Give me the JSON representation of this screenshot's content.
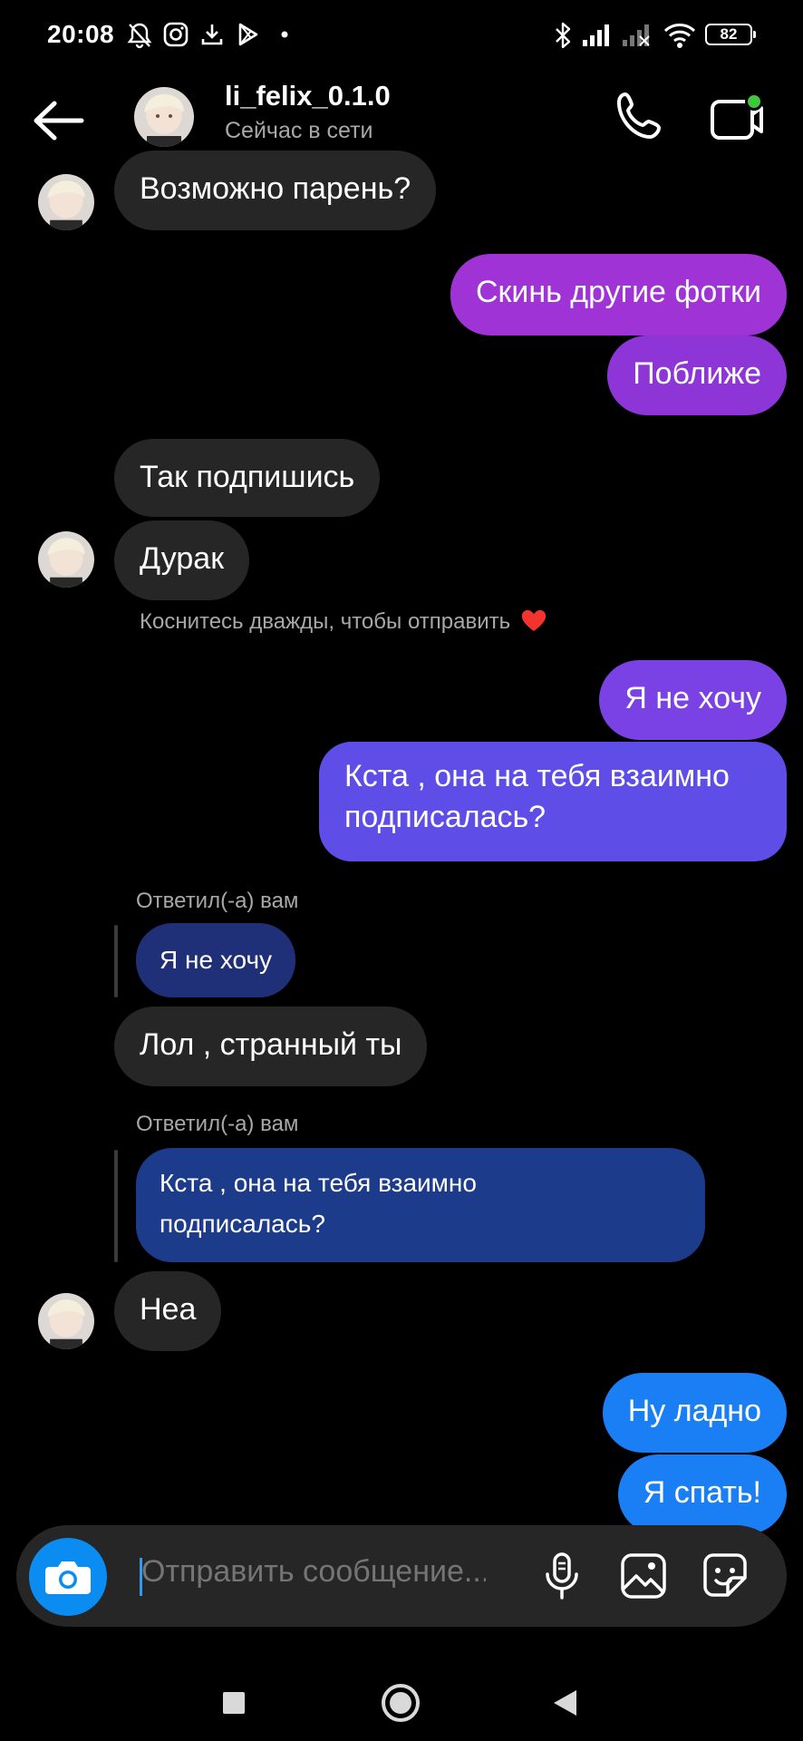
{
  "status_bar": {
    "time": "20:08",
    "battery": "82"
  },
  "header": {
    "username": "li_felix_0.1.0",
    "status": "Сейчас в сети"
  },
  "messages": {
    "m1": "Возможно парень?",
    "m2": "Скинь другие фотки",
    "m3": "Поближе",
    "m4": "Так  подпишись",
    "m5": "Дурак",
    "hint": "Коснитесь дважды, чтобы отправить",
    "m6": "Я не хочу",
    "m7_line1": "Кста , она на тебя взаимно",
    "m7_line2": "подписалась?",
    "reply1_label": "Ответил(-а) вам",
    "reply1_quote": "Я не хочу",
    "m8": "Лол , странный ты",
    "reply2_label": "Ответил(-а) вам",
    "reply2_quote_line1": "Кста , она на тебя взаимно",
    "reply2_quote_line2": "подписалась?",
    "m9": "Неа",
    "m10": "Ну ладно",
    "m11": "Я спать!"
  },
  "composer": {
    "placeholder": "Отправить сообщение..."
  },
  "colors": {
    "incoming": "#262626",
    "outgoing_top": "#a033d6",
    "outgoing_mid": "#6a4ae8",
    "outgoing_bottom": "#1a7ff5",
    "camera": "#0a8cf0",
    "online_dot": "#3ec83e"
  }
}
